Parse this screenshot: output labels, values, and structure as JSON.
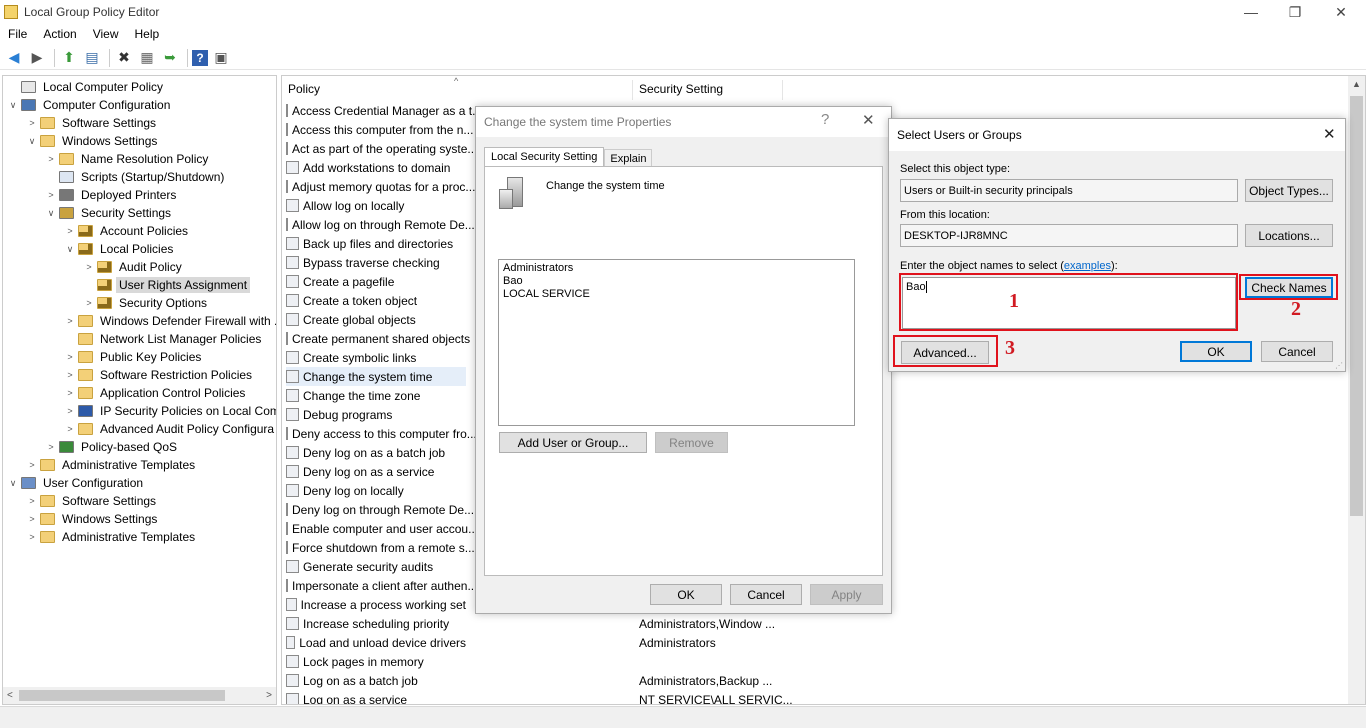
{
  "window": {
    "title": "Local Group Policy Editor",
    "minimize": "—",
    "restore": "❐",
    "close": "✕"
  },
  "menu": [
    "File",
    "Action",
    "View",
    "Help"
  ],
  "toolbar": {
    "back": "◀",
    "forward": "▶",
    "up": "⬆",
    "show_hide": "▤",
    "delete": "✖",
    "properties": "▦",
    "export": "➥",
    "help": "?",
    "view": "▣"
  },
  "tree": [
    {
      "label": "Local Computer Policy",
      "level": 0,
      "chev": "",
      "icon": "computer-policy-icon"
    },
    {
      "label": "Computer Configuration",
      "level": 0,
      "chev": "∨",
      "icon": "computer-icon"
    },
    {
      "label": "Software Settings",
      "level": 1,
      "chev": ">",
      "icon": "folder-icon"
    },
    {
      "label": "Windows Settings",
      "level": 1,
      "chev": "∨",
      "icon": "folder-icon"
    },
    {
      "label": "Name Resolution Policy",
      "level": 2,
      "chev": ">",
      "icon": "folder-icon"
    },
    {
      "label": "Scripts (Startup/Shutdown)",
      "level": 2,
      "chev": "",
      "icon": "scripts-icon"
    },
    {
      "label": "Deployed Printers",
      "level": 2,
      "chev": ">",
      "icon": "printer-icon"
    },
    {
      "label": "Security Settings",
      "level": 2,
      "chev": "∨",
      "icon": "security-icon"
    },
    {
      "label": "Account Policies",
      "level": 3,
      "chev": ">",
      "icon": "folder-lock-icon"
    },
    {
      "label": "Local Policies",
      "level": 3,
      "chev": "∨",
      "icon": "folder-lock-icon"
    },
    {
      "label": "Audit Policy",
      "level": 4,
      "chev": ">",
      "icon": "folder-lock-icon"
    },
    {
      "label": "User Rights Assignment",
      "level": 4,
      "chev": "",
      "icon": "folder-lock-icon",
      "selected": true
    },
    {
      "label": "Security Options",
      "level": 4,
      "chev": ">",
      "icon": "folder-lock-icon"
    },
    {
      "label": "Windows Defender Firewall with ...",
      "level": 3,
      "chev": ">",
      "icon": "folder-icon"
    },
    {
      "label": "Network List Manager Policies",
      "level": 3,
      "chev": "",
      "icon": "folder-icon"
    },
    {
      "label": "Public Key Policies",
      "level": 3,
      "chev": ">",
      "icon": "folder-icon"
    },
    {
      "label": "Software Restriction Policies",
      "level": 3,
      "chev": ">",
      "icon": "folder-icon"
    },
    {
      "label": "Application Control Policies",
      "level": 3,
      "chev": ">",
      "icon": "folder-icon"
    },
    {
      "label": "IP Security Policies on Local Com",
      "level": 3,
      "chev": ">",
      "icon": "ipsec-icon"
    },
    {
      "label": "Advanced Audit Policy Configura",
      "level": 3,
      "chev": ">",
      "icon": "folder-icon"
    },
    {
      "label": "Policy-based QoS",
      "level": 2,
      "chev": ">",
      "icon": "qos-icon"
    },
    {
      "label": "Administrative Templates",
      "level": 1,
      "chev": ">",
      "icon": "folder-icon"
    },
    {
      "label": "User Configuration",
      "level": 0,
      "chev": "∨",
      "icon": "user-icon"
    },
    {
      "label": "Software Settings",
      "level": 1,
      "chev": ">",
      "icon": "folder-icon"
    },
    {
      "label": "Windows Settings",
      "level": 1,
      "chev": ">",
      "icon": "folder-icon"
    },
    {
      "label": "Administrative Templates",
      "level": 1,
      "chev": ">",
      "icon": "folder-icon"
    }
  ],
  "list": {
    "col_policy": "Policy",
    "col_setting": "Security Setting",
    "rows": [
      {
        "policy": "Access Credential Manager as a t...",
        "setting": ""
      },
      {
        "policy": "Access this computer from the n...",
        "setting": ""
      },
      {
        "policy": "Act as part of the operating syste...",
        "setting": ""
      },
      {
        "policy": "Add workstations to domain",
        "setting": ""
      },
      {
        "policy": "Adjust memory quotas for a proc...",
        "setting": ""
      },
      {
        "policy": "Allow log on locally",
        "setting": ""
      },
      {
        "policy": "Allow log on through Remote De...",
        "setting": ""
      },
      {
        "policy": "Back up files and directories",
        "setting": ""
      },
      {
        "policy": "Bypass traverse checking",
        "setting": ""
      },
      {
        "policy": "Create a pagefile",
        "setting": ""
      },
      {
        "policy": "Create a token object",
        "setting": ""
      },
      {
        "policy": "Create global objects",
        "setting": ""
      },
      {
        "policy": "Create permanent shared objects",
        "setting": ""
      },
      {
        "policy": "Create symbolic links",
        "setting": ""
      },
      {
        "policy": "Change the system time",
        "setting": "",
        "selected": true
      },
      {
        "policy": "Change the time zone",
        "setting": ""
      },
      {
        "policy": "Debug programs",
        "setting": ""
      },
      {
        "policy": "Deny access to this computer fro...",
        "setting": ""
      },
      {
        "policy": "Deny log on as a batch job",
        "setting": ""
      },
      {
        "policy": "Deny log on as a service",
        "setting": ""
      },
      {
        "policy": "Deny log on locally",
        "setting": ""
      },
      {
        "policy": "Deny log on through Remote De...",
        "setting": ""
      },
      {
        "policy": "Enable computer and user accou...",
        "setting": ""
      },
      {
        "policy": "Force shutdown from a remote s...",
        "setting": ""
      },
      {
        "policy": "Generate security audits",
        "setting": ""
      },
      {
        "policy": "Impersonate a client after authen...",
        "setting": ""
      },
      {
        "policy": "Increase a process working set",
        "setting": ""
      },
      {
        "policy": "Increase scheduling priority",
        "setting": "Administrators,Window ..."
      },
      {
        "policy": "Load and unload device drivers",
        "setting": "Administrators"
      },
      {
        "policy": "Lock pages in memory",
        "setting": ""
      },
      {
        "policy": "Log on as a batch job",
        "setting": "Administrators,Backup ..."
      },
      {
        "policy": "Log on as a service",
        "setting": "NT SERVICE\\ALL SERVIC..."
      }
    ]
  },
  "props_dialog": {
    "title": "Change the system time Properties",
    "help": "?",
    "close": "✕",
    "tabs": [
      "Local Security Setting",
      "Explain"
    ],
    "policy_name": "Change the system time",
    "members": [
      "Administrators",
      "Bao",
      "LOCAL SERVICE"
    ],
    "add_button": "Add User or Group...",
    "remove_button": "Remove",
    "ok": "OK",
    "cancel": "Cancel",
    "apply": "Apply"
  },
  "select_dialog": {
    "title": "Select Users or Groups",
    "close": "✕",
    "object_type_label": "Select this object type:",
    "object_type_value": "Users or Built-in security principals",
    "object_types_button": "Object Types...",
    "location_label": "From this location:",
    "location_value": "DESKTOP-IJR8MNC",
    "locations_button": "Locations...",
    "names_label_prefix": "Enter the object names to select (",
    "names_label_link": "examples",
    "names_label_suffix": "):",
    "names_value": "Bao",
    "check_names_button": "Check Names",
    "advanced_button": "Advanced...",
    "ok": "OK",
    "cancel": "Cancel"
  },
  "annotations": {
    "one": "1",
    "two": "2",
    "three": "3",
    "color": "#e0121c"
  }
}
